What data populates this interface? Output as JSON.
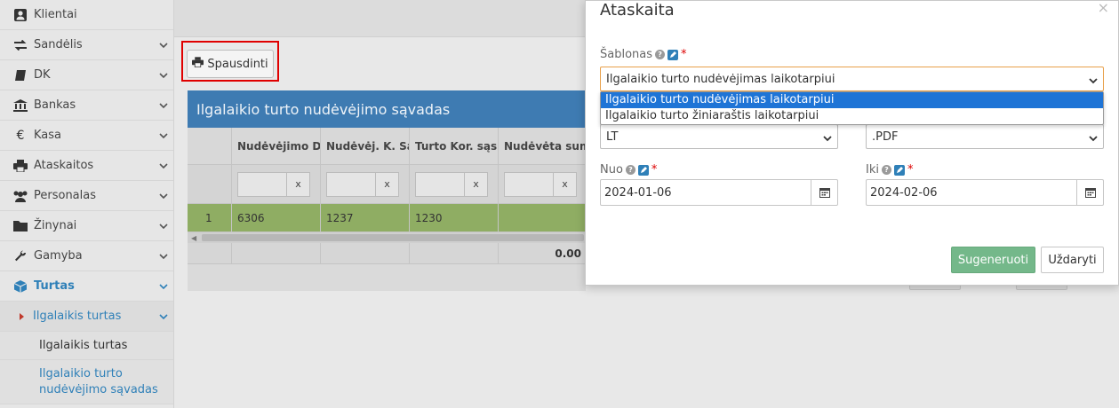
{
  "sidebar": {
    "items": [
      {
        "label": "Klientai",
        "icon": "user-icon"
      },
      {
        "label": "Sandėlis",
        "icon": "exchange-icon"
      },
      {
        "label": "DK",
        "icon": "book-icon"
      },
      {
        "label": "Bankas",
        "icon": "bank-icon"
      },
      {
        "label": "Kasa",
        "icon": "euro-icon"
      },
      {
        "label": "Ataskaitos",
        "icon": "print-icon"
      },
      {
        "label": "Personalas",
        "icon": "users-icon"
      },
      {
        "label": "Žinynai",
        "icon": "folder-icon"
      },
      {
        "label": "Gamyba",
        "icon": "wrench-icon"
      },
      {
        "label": "Turtas",
        "icon": "cube-icon"
      }
    ],
    "submenu": {
      "label": "Ilgalaikis turtas"
    },
    "leaves": [
      "Ilgalaikis turtas",
      "Ilgalaikio turto nudėvėjimo sąvadas"
    ]
  },
  "toolbar": {
    "print_label": "Spausdinti"
  },
  "grid": {
    "title": "Ilgalaikio turto nudėvėjimo sąvadas",
    "columns": [
      "Nudėvėjimo D",
      "Nudėvėj. K. Są",
      "Turto Kor. sąsk",
      "Nudėvėta sum"
    ],
    "filter_clear": "x",
    "rows": [
      {
        "num": "1",
        "cells": [
          "6306",
          "1237",
          "1230",
          ""
        ]
      }
    ],
    "footer_total": "0.00"
  },
  "modal": {
    "title": "Ataskaita",
    "close": "×",
    "template_label": "Šablonas",
    "template_value": "Ilgalaikio turto nudėvėjimas laikotarpiui",
    "template_options": [
      "Ilgalaikio turto nudėvėjimas laikotarpiui",
      "Ilgalaikio turto žiniaraštis laikotarpiui"
    ],
    "language_value": "LT",
    "format_value": ".PDF",
    "from_label": "Nuo",
    "from_value": "2024-01-06",
    "to_label": "Iki",
    "to_value": "2024-02-06",
    "generate_label": "Sugeneruoti",
    "close_label": "Uždaryti",
    "required_mark": "*",
    "help_mark": "?"
  },
  "colors": {
    "accent": "#2f80b8",
    "primary_button": "#74b88a",
    "highlight": "#e00000",
    "dropdown_selected": "#1e74d6"
  }
}
